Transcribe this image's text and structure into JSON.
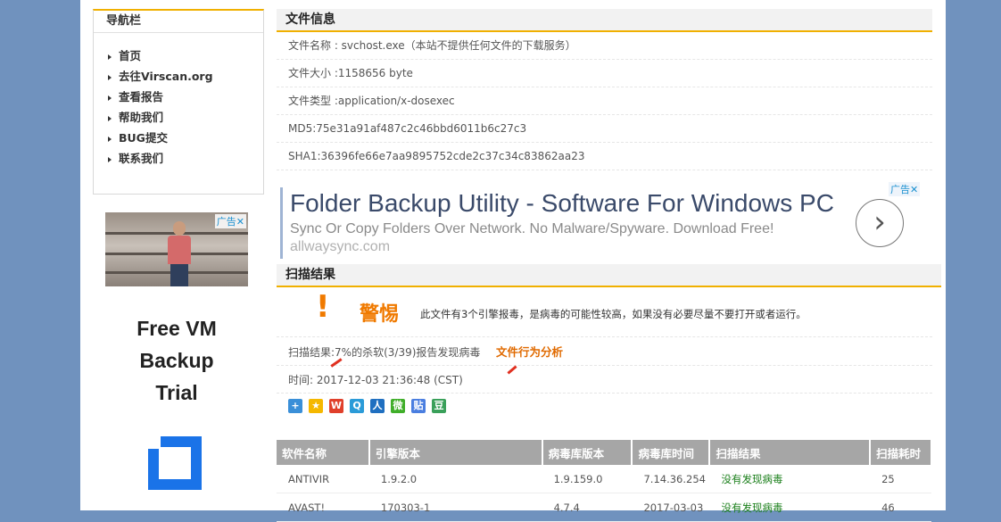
{
  "nav": {
    "title": "导航栏",
    "items": [
      "首页",
      "去往Virscan.org",
      "查看报告",
      "帮助我们",
      "BUG提交",
      "联系我们"
    ]
  },
  "left_ad": {
    "badge": "广告",
    "text_lines": [
      "Free VM",
      "Backup",
      "Trial"
    ],
    "close": "✕"
  },
  "file_info": {
    "title": "文件信息",
    "rows": [
      "文件名称 : svchost.exe（本站不提供任何文件的下载服务）",
      "文件大小 :1158656 byte",
      "文件类型 :application/x-dosexec",
      "MD5:75e31a91af487c2c46bbd6011b6c27c3",
      "SHA1:36396fe66e7aa9895752cde2c37c34c83862aa23"
    ]
  },
  "banner": {
    "title": "Folder Backup Utility - Software For Windows PC",
    "subtitle": "Sync Or Copy Folders Over Network. No Malware/Spyware. Download Free!",
    "url": "allwaysync.com",
    "badge": "广告",
    "close": "✕",
    "arrow": "›"
  },
  "scan": {
    "title": "扫描结果",
    "warning_mark": "!",
    "warning_word": "警惕",
    "warning_text": "此文件有3个引擎报毒，是病毒的可能性较高，如果没有必要尽量不要打开或者运行。",
    "result_text": "扫描结果:7%的杀软(3/39)报告发现病毒",
    "behavior_link": "文件行为分析",
    "time_text": "时间: 2017-12-03 21:36:48 (CST)"
  },
  "share_icons": [
    {
      "name": "share-more-icon",
      "glyph": "+",
      "color": "#3a8fd8"
    },
    {
      "name": "qzone-icon",
      "glyph": "★",
      "color": "#f5b800"
    },
    {
      "name": "weibo-icon",
      "glyph": "W",
      "color": "#e0402b"
    },
    {
      "name": "tencent-weibo-icon",
      "glyph": "Q",
      "color": "#2b9bd8"
    },
    {
      "name": "renren-icon",
      "glyph": "人",
      "color": "#1f6fc0"
    },
    {
      "name": "wechat-icon",
      "glyph": "微",
      "color": "#3fae29"
    },
    {
      "name": "tieba-icon",
      "glyph": "贴",
      "color": "#4a7ee0"
    },
    {
      "name": "douban-icon",
      "glyph": "豆",
      "color": "#3aa05a"
    }
  ],
  "table": {
    "headers": [
      "软件名称",
      "引擎版本",
      "病毒库版本",
      "病毒库时间",
      "扫描结果",
      "扫描耗时"
    ],
    "rows": [
      [
        "ANTIVIR",
        "1.9.2.0",
        "1.9.159.0",
        "7.14.36.254",
        "没有发现病毒",
        "25"
      ],
      [
        "AVAST!",
        "170303-1",
        "4.7.4",
        "2017-03-03",
        "没有发现病毒",
        "46"
      ]
    ]
  }
}
